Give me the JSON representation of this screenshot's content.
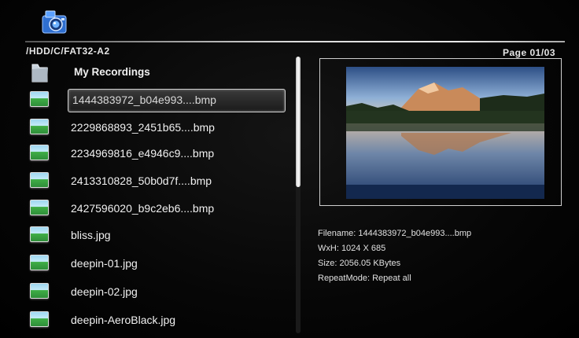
{
  "header": {
    "path": "/HDD/C/FAT32-A2",
    "page": "Page 01/03",
    "app_icon": "camera-icon"
  },
  "file_list": {
    "items": [
      {
        "label": "My Recordings",
        "kind": "folder",
        "icon": "folder-icon",
        "selected": false
      },
      {
        "label": "1444383972_b04e993....bmp",
        "kind": "image",
        "icon": "image-file-icon",
        "selected": true
      },
      {
        "label": "2229868893_2451b65....bmp",
        "kind": "image",
        "icon": "image-file-icon",
        "selected": false
      },
      {
        "label": "2234969816_e4946c9....bmp",
        "kind": "image",
        "icon": "image-file-icon",
        "selected": false
      },
      {
        "label": "2413310828_50b0d7f....bmp",
        "kind": "image",
        "icon": "image-file-icon",
        "selected": false
      },
      {
        "label": "2427596020_b9c2eb6....bmp",
        "kind": "image",
        "icon": "image-file-icon",
        "selected": false
      },
      {
        "label": "bliss.jpg",
        "kind": "image",
        "icon": "image-file-icon",
        "selected": false
      },
      {
        "label": "deepin-01.jpg",
        "kind": "image",
        "icon": "image-file-icon",
        "selected": false
      },
      {
        "label": "deepin-02.jpg",
        "kind": "image",
        "icon": "image-file-icon",
        "selected": false
      },
      {
        "label": "deepin-AeroBlack.jpg",
        "kind": "image",
        "icon": "image-file-icon",
        "selected": false
      }
    ]
  },
  "info": {
    "filename": "Filename: 1444383972_b04e993....bmp",
    "dimensions": "WxH: 1024 X 685",
    "size": "Size: 2056.05 KBytes",
    "repeat": "RepeatMode: Repeat all"
  }
}
